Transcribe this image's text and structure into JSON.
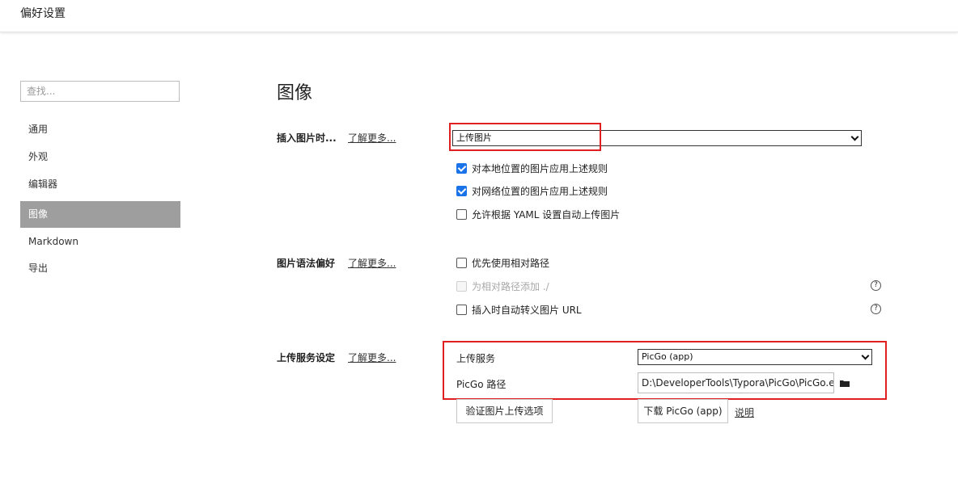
{
  "window": {
    "title": "偏好设置"
  },
  "sidebar": {
    "search_placeholder": "查找...",
    "items": [
      {
        "label": "通用"
      },
      {
        "label": "外观"
      },
      {
        "label": "编辑器"
      },
      {
        "label": "图像",
        "active": true
      },
      {
        "label": "Markdown"
      },
      {
        "label": "导出"
      }
    ]
  },
  "main": {
    "title": "图像",
    "insert_image": {
      "label": "插入图片时...",
      "learn_more": "了解更多...",
      "action_value": "上传图片",
      "options": [
        {
          "label": "对本地位置的图片应用上述规则",
          "checked": true
        },
        {
          "label": "对网络位置的图片应用上述规则",
          "checked": true
        },
        {
          "label": "允许根据 YAML 设置自动上传图片",
          "checked": false
        }
      ]
    },
    "image_syntax": {
      "label": "图片语法偏好",
      "learn_more": "了解更多...",
      "options": [
        {
          "label": "优先使用相对路径",
          "checked": false,
          "disabled": false
        },
        {
          "label": "为相对路径添加 ./",
          "checked": false,
          "disabled": true
        },
        {
          "label": "插入时自动转义图片 URL",
          "checked": false,
          "disabled": false
        }
      ],
      "help_icon": "?"
    },
    "upload_service": {
      "label": "上传服务设定",
      "learn_more": "了解更多...",
      "service_label": "上传服务",
      "service_value": "PicGo (app)",
      "path_label": "PicGo 路径",
      "path_value": "D:\\DeveloperTools\\Typora\\PicGo\\PicGo.exe",
      "verify_button": "验证图片上传选项",
      "download_button": "下载 PicGo (app)",
      "explain_link": "说明"
    }
  },
  "colors": {
    "highlight_box": "#e02020",
    "sidebar_active_bg": "#9e9e9e",
    "checkbox_checked": "#1a73e8"
  },
  "icons": {
    "help": "help-circle-icon",
    "folder": "folder-icon",
    "dropdown": "chevron-down-icon"
  }
}
